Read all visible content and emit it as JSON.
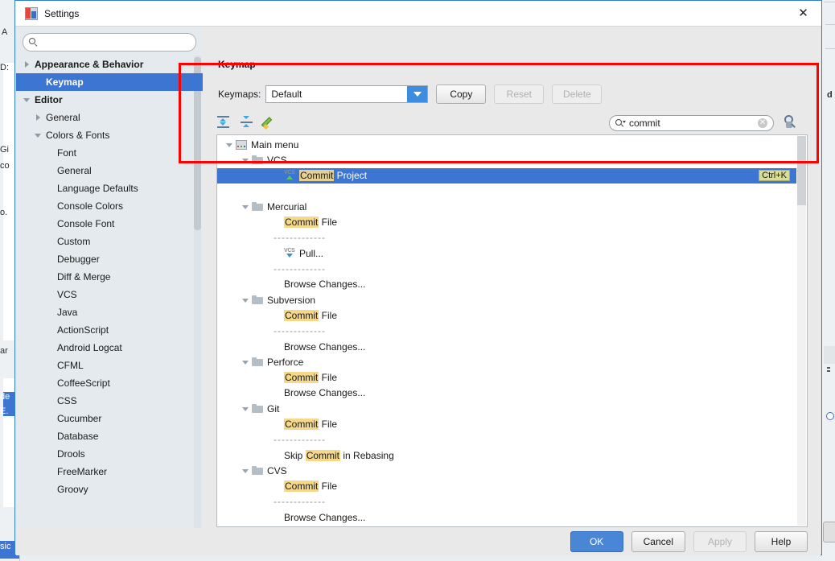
{
  "window": {
    "title": "Settings",
    "app_icon": "settings-app-icon",
    "close_label": "✕"
  },
  "sidebar": {
    "search": {
      "value": "",
      "placeholder": "",
      "icon": "search-icon"
    },
    "items": [
      {
        "label": "Appearance & Behavior",
        "indent": 0,
        "arrow": "right",
        "bold": true,
        "selected": false
      },
      {
        "label": "Keymap",
        "indent": 1,
        "arrow": "none",
        "bold": true,
        "selected": true
      },
      {
        "label": "Editor",
        "indent": 0,
        "arrow": "down",
        "bold": true,
        "selected": false
      },
      {
        "label": "General",
        "indent": 1,
        "arrow": "right",
        "bold": false,
        "selected": false
      },
      {
        "label": "Colors & Fonts",
        "indent": 1,
        "arrow": "down",
        "bold": false,
        "selected": false
      },
      {
        "label": "Font",
        "indent": 2,
        "arrow": "none",
        "bold": false,
        "selected": false
      },
      {
        "label": "General",
        "indent": 2,
        "arrow": "none",
        "bold": false,
        "selected": false
      },
      {
        "label": "Language Defaults",
        "indent": 2,
        "arrow": "none",
        "bold": false,
        "selected": false
      },
      {
        "label": "Console Colors",
        "indent": 2,
        "arrow": "none",
        "bold": false,
        "selected": false
      },
      {
        "label": "Console Font",
        "indent": 2,
        "arrow": "none",
        "bold": false,
        "selected": false
      },
      {
        "label": "Custom",
        "indent": 2,
        "arrow": "none",
        "bold": false,
        "selected": false
      },
      {
        "label": "Debugger",
        "indent": 2,
        "arrow": "none",
        "bold": false,
        "selected": false
      },
      {
        "label": "Diff & Merge",
        "indent": 2,
        "arrow": "none",
        "bold": false,
        "selected": false
      },
      {
        "label": "VCS",
        "indent": 2,
        "arrow": "none",
        "bold": false,
        "selected": false
      },
      {
        "label": "Java",
        "indent": 2,
        "arrow": "none",
        "bold": false,
        "selected": false
      },
      {
        "label": "ActionScript",
        "indent": 2,
        "arrow": "none",
        "bold": false,
        "selected": false
      },
      {
        "label": "Android Logcat",
        "indent": 2,
        "arrow": "none",
        "bold": false,
        "selected": false
      },
      {
        "label": "CFML",
        "indent": 2,
        "arrow": "none",
        "bold": false,
        "selected": false
      },
      {
        "label": "CoffeeScript",
        "indent": 2,
        "arrow": "none",
        "bold": false,
        "selected": false
      },
      {
        "label": "CSS",
        "indent": 2,
        "arrow": "none",
        "bold": false,
        "selected": false
      },
      {
        "label": "Cucumber",
        "indent": 2,
        "arrow": "none",
        "bold": false,
        "selected": false
      },
      {
        "label": "Database",
        "indent": 2,
        "arrow": "none",
        "bold": false,
        "selected": false
      },
      {
        "label": "Drools",
        "indent": 2,
        "arrow": "none",
        "bold": false,
        "selected": false
      },
      {
        "label": "FreeMarker",
        "indent": 2,
        "arrow": "none",
        "bold": false,
        "selected": false
      },
      {
        "label": "Groovy",
        "indent": 2,
        "arrow": "none",
        "bold": false,
        "selected": false
      }
    ]
  },
  "main": {
    "header": "Keymap",
    "keymaps_label": "Keymaps:",
    "keymap_selected": "Default",
    "buttons": [
      {
        "label": "Copy",
        "disabled": false
      },
      {
        "label": "Reset",
        "disabled": true
      },
      {
        "label": "Delete",
        "disabled": true
      }
    ],
    "toolbar_icons": [
      {
        "name": "expand-all-icon"
      },
      {
        "name": "collapse-all-icon"
      },
      {
        "name": "edit-shortcut-icon"
      }
    ],
    "find": {
      "value": "commit",
      "placeholder": "",
      "icon": "search-icon",
      "clear_icon": "clear-icon"
    },
    "filter_icon": "find-by-shortcut-icon",
    "highlight_term": "Commit",
    "tree": [
      {
        "type": "folder",
        "icon": "main-menu-icon",
        "indent": 0,
        "arrow": "down",
        "text": "Main menu"
      },
      {
        "type": "folder",
        "icon": "folder-icon",
        "indent": 1,
        "arrow": "down",
        "text": "VCS"
      },
      {
        "type": "action",
        "icon": "vcs-commit-icon",
        "indent": 3,
        "arrow": "none",
        "text": "Commit Project",
        "selected": true,
        "shortcut": "Ctrl+K"
      },
      {
        "type": "blank",
        "indent": 3
      },
      {
        "type": "folder",
        "icon": "folder-icon",
        "indent": 1,
        "arrow": "down",
        "text": "Mercurial"
      },
      {
        "type": "action",
        "icon": "none",
        "indent": 3,
        "arrow": "none",
        "text": "Commit File"
      },
      {
        "type": "separator",
        "indent": 3,
        "text": "-------------"
      },
      {
        "type": "action",
        "icon": "vcs-pull-icon",
        "indent": 3,
        "arrow": "none",
        "text": "Pull..."
      },
      {
        "type": "separator",
        "indent": 3,
        "text": "-------------"
      },
      {
        "type": "action",
        "icon": "none",
        "indent": 3,
        "arrow": "none",
        "text": "Browse Changes..."
      },
      {
        "type": "folder",
        "icon": "folder-icon",
        "indent": 1,
        "arrow": "down",
        "text": "Subversion"
      },
      {
        "type": "action",
        "icon": "none",
        "indent": 3,
        "arrow": "none",
        "text": "Commit File"
      },
      {
        "type": "separator",
        "indent": 3,
        "text": "-------------"
      },
      {
        "type": "action",
        "icon": "none",
        "indent": 3,
        "arrow": "none",
        "text": "Browse Changes..."
      },
      {
        "type": "folder",
        "icon": "folder-icon",
        "indent": 1,
        "arrow": "down",
        "text": "Perforce"
      },
      {
        "type": "action",
        "icon": "none",
        "indent": 3,
        "arrow": "none",
        "text": "Commit File"
      },
      {
        "type": "action",
        "icon": "none",
        "indent": 3,
        "arrow": "none",
        "text": "Browse Changes..."
      },
      {
        "type": "folder",
        "icon": "folder-icon",
        "indent": 1,
        "arrow": "down",
        "text": "Git"
      },
      {
        "type": "action",
        "icon": "none",
        "indent": 3,
        "arrow": "none",
        "text": "Commit File"
      },
      {
        "type": "separator",
        "indent": 3,
        "text": "-------------"
      },
      {
        "type": "action",
        "icon": "none",
        "indent": 3,
        "arrow": "none",
        "text": "Skip Commit in Rebasing"
      },
      {
        "type": "folder",
        "icon": "folder-icon",
        "indent": 1,
        "arrow": "down",
        "text": "CVS"
      },
      {
        "type": "action",
        "icon": "none",
        "indent": 3,
        "arrow": "none",
        "text": "Commit File"
      },
      {
        "type": "separator",
        "indent": 3,
        "text": "-------------"
      },
      {
        "type": "action",
        "icon": "none",
        "indent": 3,
        "arrow": "none",
        "text": "Browse Changes..."
      }
    ]
  },
  "footer": {
    "buttons": [
      {
        "label": "OK",
        "style": "primary",
        "disabled": false
      },
      {
        "label": "Cancel",
        "style": "normal",
        "disabled": false
      },
      {
        "label": "Apply",
        "style": "normal",
        "disabled": true
      },
      {
        "label": "Help",
        "style": "normal",
        "disabled": false
      }
    ]
  },
  "annotation": {
    "name": "red-highlight-rectangle",
    "color": "#ff0000"
  },
  "background": {
    "left_fragments": [
      "A",
      "D:",
      "Gi",
      "co",
      "o.",
      "ar",
      "de",
      "E.",
      "sic"
    ],
    "right_fragments": [
      "d"
    ]
  },
  "colors": {
    "accent_blue": "#3c76d2",
    "highlight_yellow": "#f5d88a",
    "shortcut_yellow": "#d8dc96",
    "annotation_red": "#ff0000"
  }
}
